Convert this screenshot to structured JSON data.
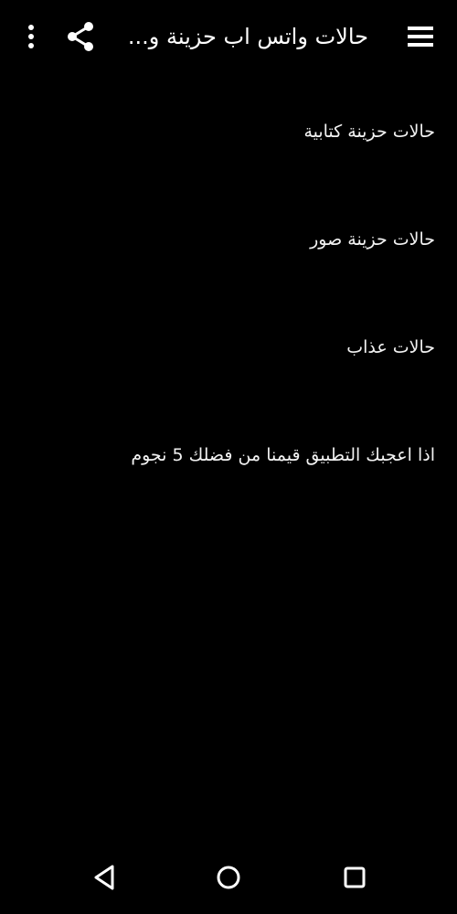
{
  "app_bar": {
    "title": "حالات واتس اب حزينة و...",
    "menu_icon": "more-vert-icon",
    "share_icon": "share-icon",
    "drawer_icon": "hamburger-menu-icon"
  },
  "list": {
    "items": [
      {
        "label": "حالات حزينة كتابية"
      },
      {
        "label": "حالات حزينة صور"
      },
      {
        "label": "حالات عذاب"
      },
      {
        "label": "اذا اعجبك التطبيق قيمنا من فضلك 5 نجوم"
      }
    ]
  },
  "nav_bar": {
    "back_icon": "back-triangle-icon",
    "home_icon": "home-circle-icon",
    "recents_icon": "recents-square-icon"
  },
  "colors": {
    "background": "#000000",
    "text": "#ffffff"
  }
}
